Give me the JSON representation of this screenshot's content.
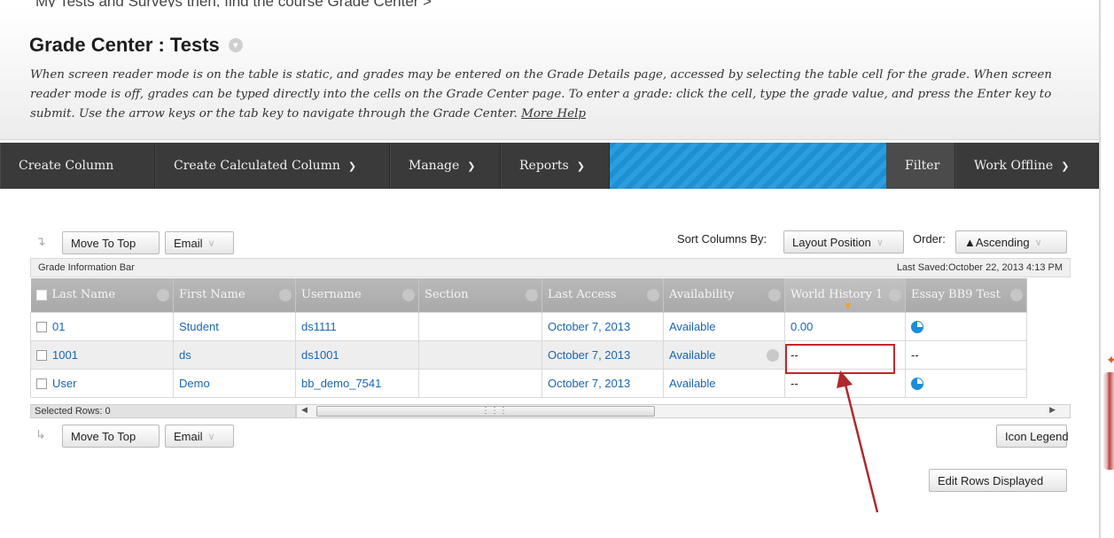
{
  "page": {
    "top_caption": "My Tests and Surveys then, find the course Grade Center >",
    "title": "Grade Center : Tests",
    "description": "When screen reader mode is on the table is static, and grades may be entered on the Grade Details page, accessed by selecting the table cell for the grade. When screen reader mode is off, grades can be typed directly into the cells on the Grade Center page. To enter a grade: click the cell, type the grade value, and press the Enter key to submit. Use the arrow keys or the tab key to navigate through the Grade Center.",
    "more_help": "More Help"
  },
  "action_bar": {
    "create_column": "Create Column",
    "create_calculated": "Create Calculated Column",
    "manage": "Manage",
    "reports": "Reports",
    "filter": "Filter",
    "work_offline": "Work Offline"
  },
  "toolbar_top": {
    "move_to_top": "Move To Top",
    "email": "Email",
    "sort_label": "Sort Columns By:",
    "sort_value": "Layout Position",
    "order_label": "Order:",
    "order_value": "▲Ascending"
  },
  "info_bar": {
    "label": "Grade Information Bar",
    "last_saved": "Last Saved:October 22, 2013 4:13 PM"
  },
  "table": {
    "headers": [
      "Last Name",
      "First Name",
      "Username",
      "Section",
      "Last Access",
      "Availability",
      "World History 1",
      "Essay BB9 Test"
    ],
    "rows": [
      {
        "last": "01",
        "first": "Student",
        "user": "ds1111",
        "section": "",
        "access": "October 7, 2013",
        "avail": "Available",
        "grade1": "0.00",
        "grade2_icon": "needs-grading-icon"
      },
      {
        "last": "1001",
        "first": "ds",
        "user": "ds1001",
        "section": "",
        "access": "October 7, 2013",
        "avail": "Available",
        "grade1": "--",
        "grade2": "--"
      },
      {
        "last": "User",
        "first": "Demo",
        "user": "bb_demo_7541",
        "section": "",
        "access": "October 7, 2013",
        "avail": "Available",
        "grade1": "--",
        "grade2_icon": "needs-grading-icon"
      }
    ],
    "selected_rows": "Selected Rows: 0"
  },
  "toolbar_bottom": {
    "move_to_top": "Move To Top",
    "email": "Email",
    "icon_legend": "Icon Legend",
    "edit_rows": "Edit Rows Displayed"
  },
  "colors": {
    "action_bar": "#3a3a3a",
    "link": "#1a66b3",
    "highlight": "#c0282d",
    "accent_stripe": "#1e8fd1"
  }
}
